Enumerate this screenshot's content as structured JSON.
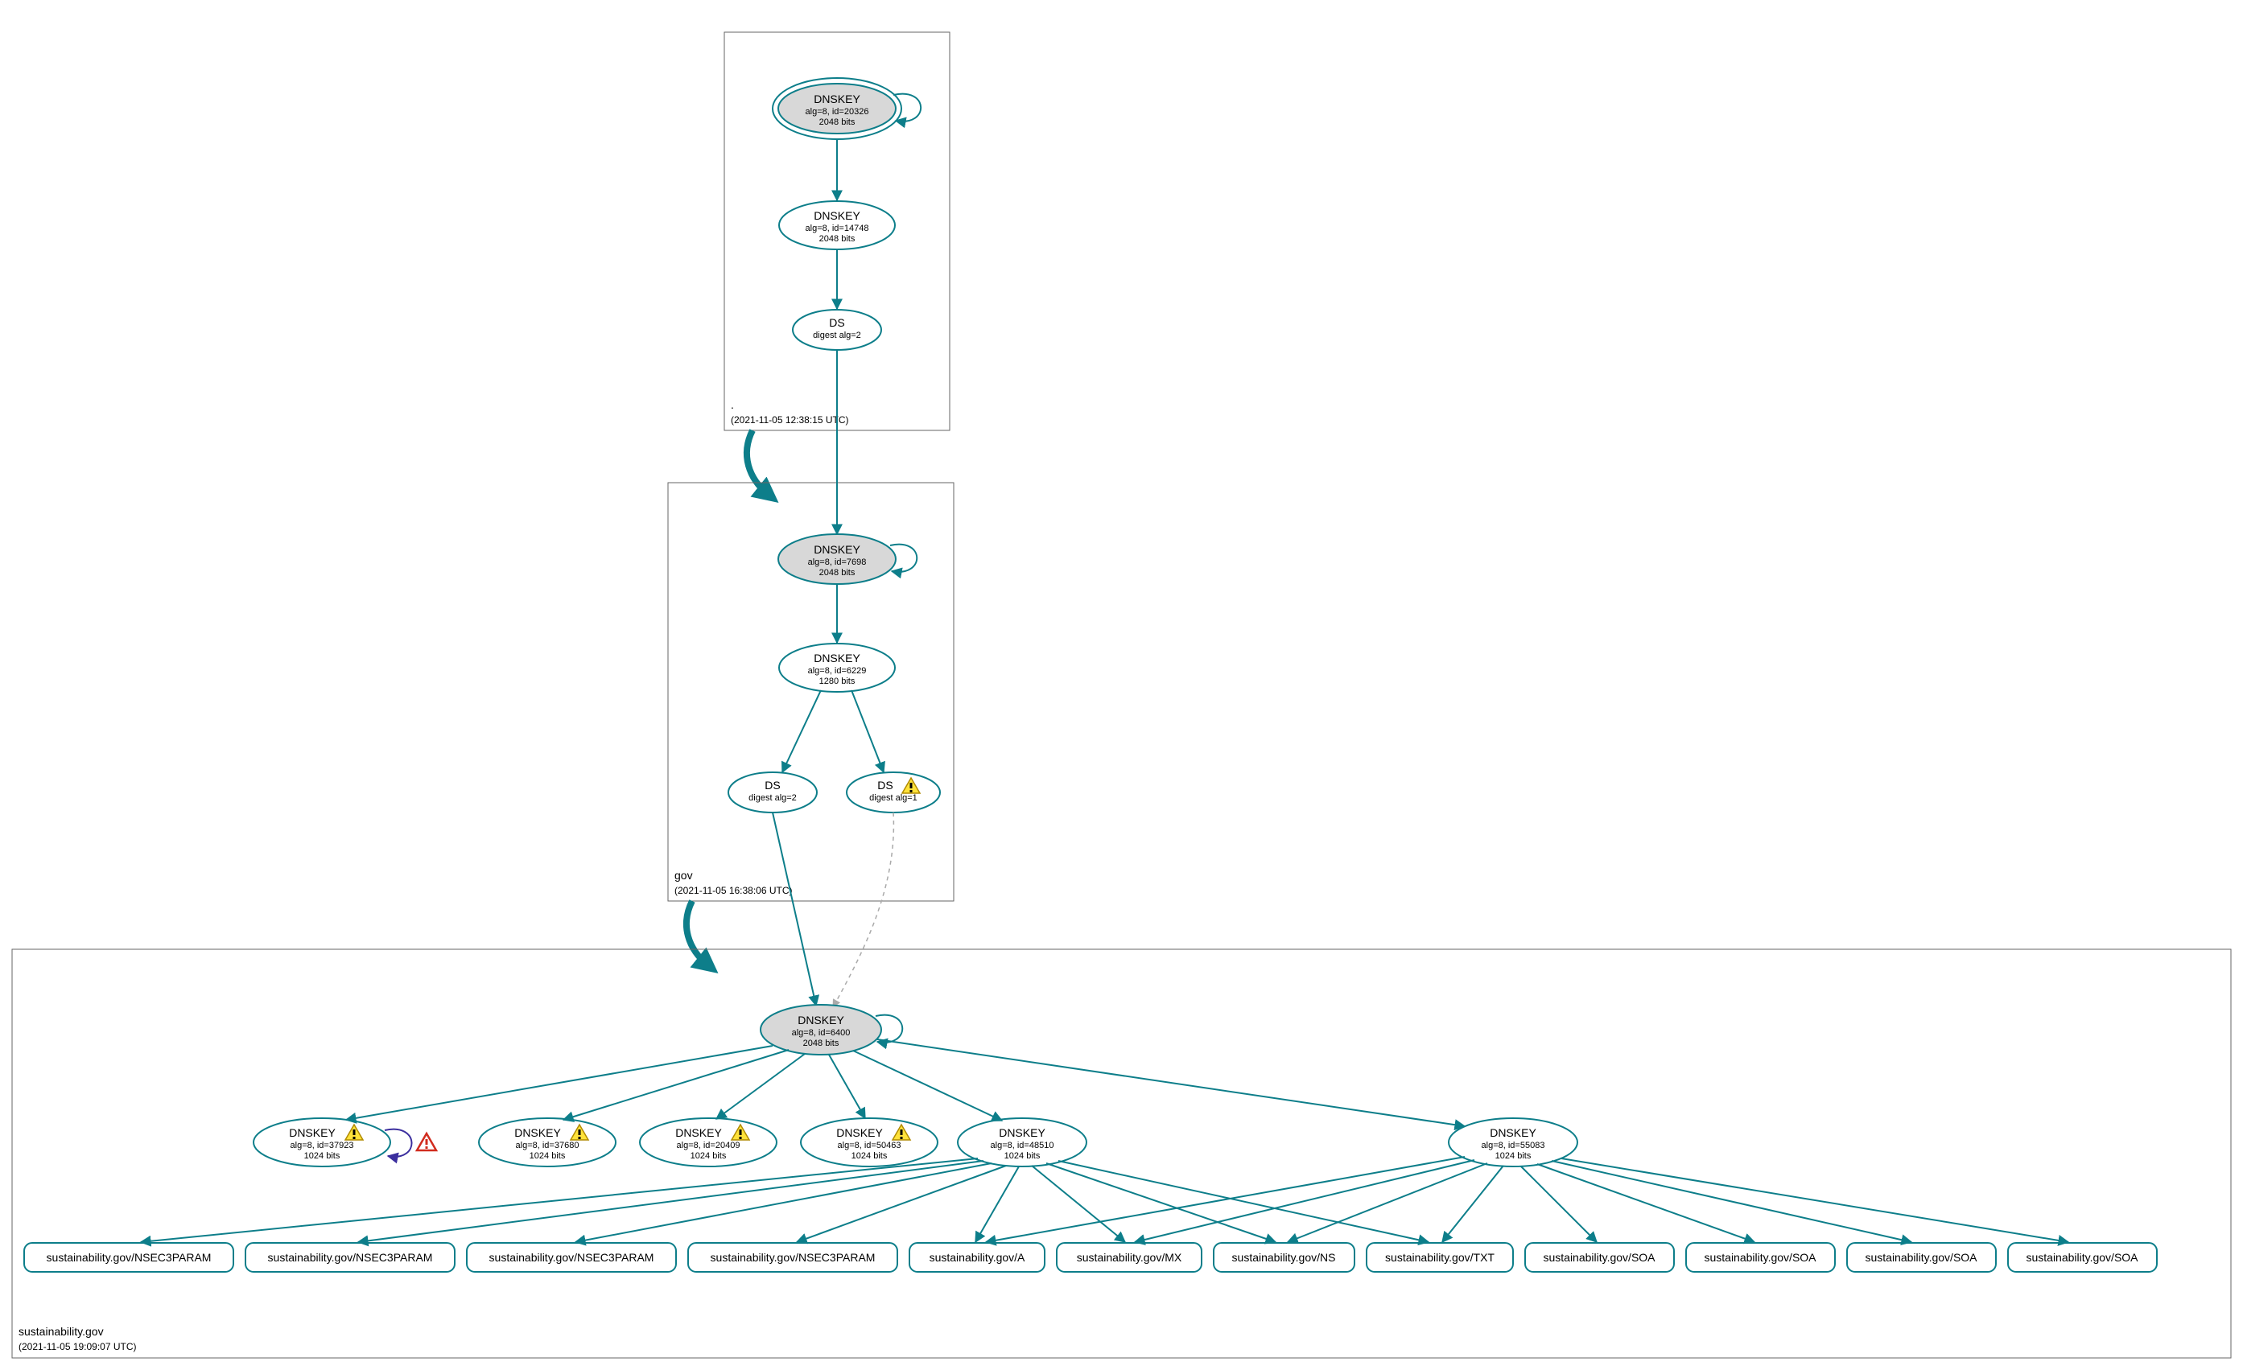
{
  "zones": {
    "root": {
      "label": ".",
      "timestamp": "(2021-11-05 12:38:15 UTC)",
      "nodes": {
        "ksk": {
          "title": "DNSKEY",
          "line1": "alg=8, id=20326",
          "line2": "2048 bits"
        },
        "zsk": {
          "title": "DNSKEY",
          "line1": "alg=8, id=14748",
          "line2": "2048 bits"
        },
        "ds": {
          "title": "DS",
          "line1": "digest alg=2"
        }
      }
    },
    "gov": {
      "label": "gov",
      "timestamp": "(2021-11-05 16:38:06 UTC)",
      "nodes": {
        "ksk": {
          "title": "DNSKEY",
          "line1": "alg=8, id=7698",
          "line2": "2048 bits"
        },
        "zsk": {
          "title": "DNSKEY",
          "line1": "alg=8, id=6229",
          "line2": "1280 bits"
        },
        "ds2": {
          "title": "DS",
          "line1": "digest alg=2"
        },
        "ds1": {
          "title": "DS",
          "line1": "digest alg=1",
          "warn": true
        }
      }
    },
    "sust": {
      "label": "sustainability.gov",
      "timestamp": "(2021-11-05 19:09:07 UTC)",
      "nodes": {
        "ksk": {
          "title": "DNSKEY",
          "line1": "alg=8, id=6400",
          "line2": "2048 bits"
        },
        "k37923": {
          "title": "DNSKEY",
          "line1": "alg=8, id=37923",
          "line2": "1024 bits",
          "warn": true
        },
        "k37680": {
          "title": "DNSKEY",
          "line1": "alg=8, id=37680",
          "line2": "1024 bits",
          "warn": true
        },
        "k20409": {
          "title": "DNSKEY",
          "line1": "alg=8, id=20409",
          "line2": "1024 bits",
          "warn": true
        },
        "k50463": {
          "title": "DNSKEY",
          "line1": "alg=8, id=50463",
          "line2": "1024 bits",
          "warn": true
        },
        "k48510": {
          "title": "DNSKEY",
          "line1": "alg=8, id=48510",
          "line2": "1024 bits"
        },
        "k55083": {
          "title": "DNSKEY",
          "line1": "alg=8, id=55083",
          "line2": "1024 bits"
        }
      },
      "rrsets": [
        "sustainability.gov/NSEC3PARAM",
        "sustainability.gov/NSEC3PARAM",
        "sustainability.gov/NSEC3PARAM",
        "sustainability.gov/NSEC3PARAM",
        "sustainability.gov/A",
        "sustainability.gov/MX",
        "sustainability.gov/NS",
        "sustainability.gov/TXT",
        "sustainability.gov/SOA",
        "sustainability.gov/SOA",
        "sustainability.gov/SOA",
        "sustainability.gov/SOA"
      ]
    }
  },
  "colors": {
    "stroke": "#0d7e8a",
    "kskFill": "#d8d8d8",
    "dashed": "#aaaaaa",
    "purple": "#3b2e9e"
  }
}
